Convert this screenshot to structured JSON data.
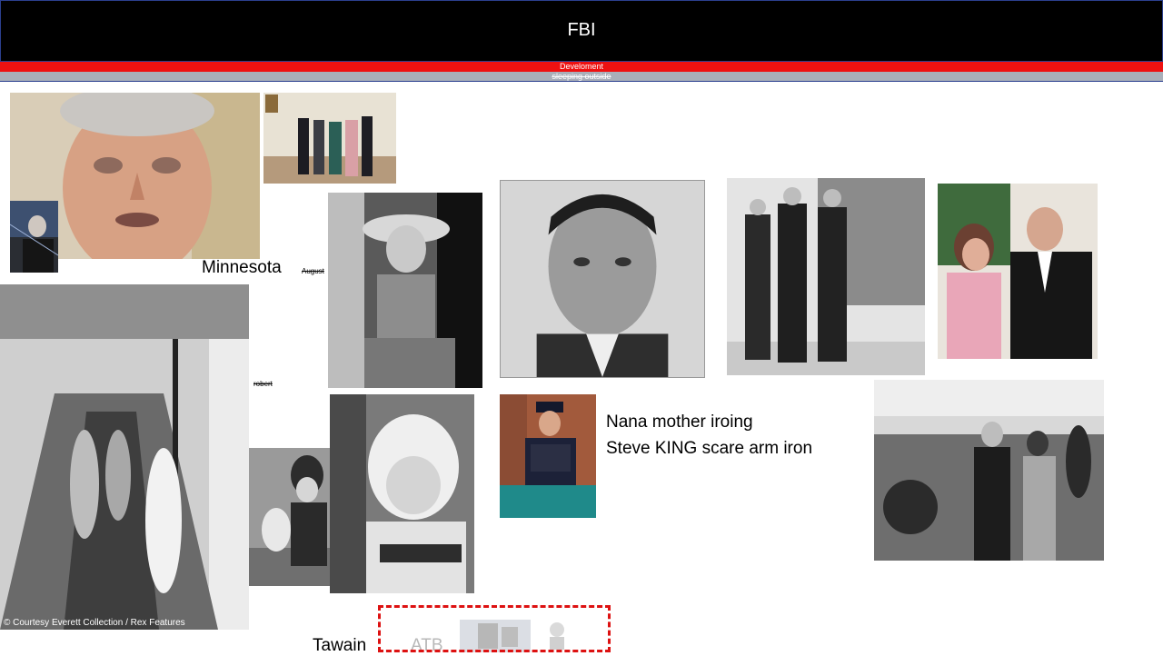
{
  "header": {
    "title": "FBI",
    "subtitle_red": "Develoment",
    "subtitle_grey": "sleeping outside"
  },
  "captions": {
    "minnesota": "Minnesota",
    "august": "August",
    "robert": "robert",
    "nana_line1": "Nana mother iroing",
    "nana_line2": "Steve KING scare arm iron",
    "tawain": "Tawain",
    "atb": "ATB",
    "watermark": "© Courtesy Everett Collection / Rex Features"
  },
  "colors": {
    "title_bg": "#000000",
    "red_strip": "#ee1111",
    "grey_strip": "#a9afb9",
    "dashed_box": "#dd1111"
  }
}
